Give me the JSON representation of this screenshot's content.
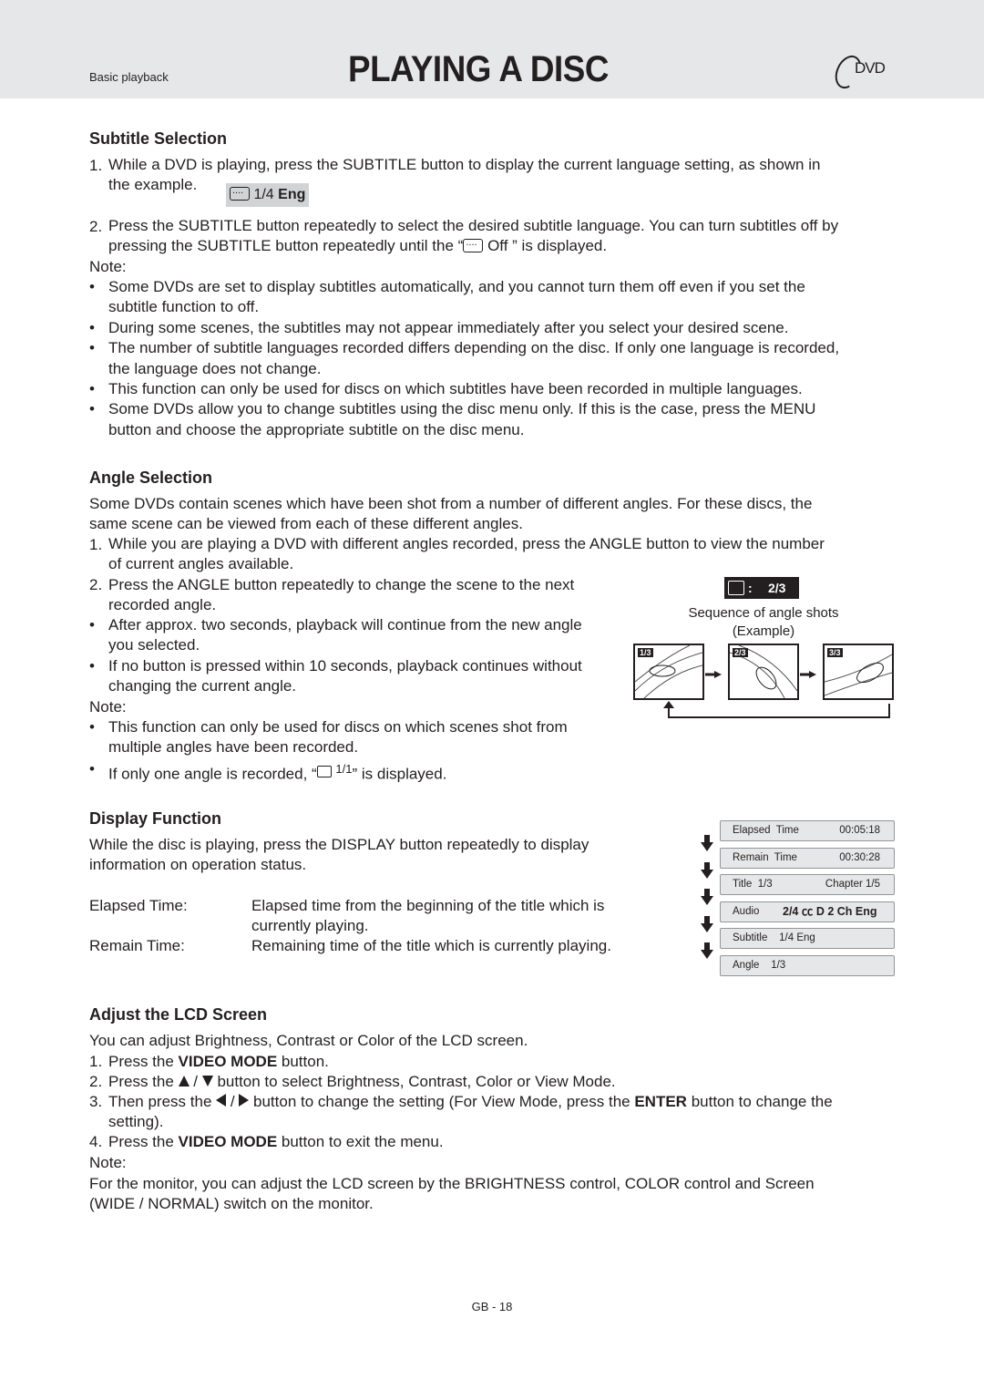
{
  "header": {
    "section": "Basic playback",
    "title": "PLAYING A DISC",
    "logo": "DVD"
  },
  "subtitle": {
    "heading": "Subtitle Selection",
    "step1_num": "1.",
    "step1_line1": "While a DVD is playing, press the SUBTITLE button to display the current language setting, as shown in",
    "step1_line2": "the example.",
    "osd_example": {
      "icon": "subtitle-icon",
      "value": "1/4",
      "lang": "Eng"
    },
    "step2_num": "2.",
    "step2_line1": "Press the SUBTITLE button repeatedly to select the desired subtitle language. You can turn subtitles off by",
    "step2_line2a": "pressing the SUBTITLE button repeatedly until the “",
    "step2_off": "Off",
    "step2_line2b": "” is displayed.",
    "note": "Note:",
    "bullets": [
      [
        "Some DVDs are set to display subtitles automatically, and you cannot turn them off even if you set the",
        "subtitle function to off."
      ],
      [
        "During some scenes, the subtitles may not appear immediately after you select your desired scene."
      ],
      [
        "The number of subtitle languages recorded differs depending on the disc. If only one language is recorded,",
        "the language does not change."
      ],
      [
        "This function can only be used for discs on which subtitles have been recorded in multiple languages."
      ],
      [
        "Some DVDs allow you to change subtitles using the disc menu only. If this is the case, press the MENU",
        "button and choose the appropriate subtitle on the disc menu."
      ]
    ]
  },
  "angle": {
    "heading": "Angle Selection",
    "intro1": "Some DVDs contain scenes which have been shot from a number of different angles. For these discs, the",
    "intro2": "same scene can be viewed from each of these different angles.",
    "step1_line1": "While you are playing a DVD with different angles recorded, press the ANGLE button to view the number",
    "step1_line2": "of current angles available.",
    "step2_line1": "Press the ANGLE button repeatedly to change the scene to the next",
    "step2_line2": "recorded angle.",
    "b1_line1": "After approx. two seconds, playback will continue from the new angle",
    "b1_line2": "you selected.",
    "b2_line1": "If no button is pressed within 10 seconds, playback continues without",
    "b2_line2": "changing the current angle.",
    "note": "Note:",
    "n1_line1": "This function can only be used for discs on which scenes shot from",
    "n1_line2": "multiple angles have been recorded.",
    "n2_a": "If only one angle is recorded, “",
    "n2_val": "1/1",
    "n2_b": "” is displayed.",
    "osd": {
      "sep": ":",
      "value": "2/3"
    },
    "caption1": "Sequence of angle shots",
    "caption2": "(Example)",
    "shots": [
      "1/3",
      "2/3",
      "3/3"
    ]
  },
  "display": {
    "heading": "Display Function",
    "intro1": "While the disc is playing, press the DISPLAY button repeatedly to display",
    "intro2": "information on operation status.",
    "defs": [
      {
        "term": "Elapsed Time:",
        "def1": "Elapsed time from the beginning of the title which is",
        "def2": "currently playing."
      },
      {
        "term": "Remain Time:",
        "def1": "Remaining time of the title which is currently playing.",
        "def2": ""
      }
    ],
    "osd_sequence": [
      {
        "label": "Elapsed  Time",
        "value": "00:05:18"
      },
      {
        "label": "Remain  Time",
        "value": "00:30:28"
      },
      {
        "label": "Title  1/3",
        "value": "Chapter  1/5"
      },
      {
        "label": "Audio",
        "value": "2/4 ㏄ D 2 Ch Eng"
      },
      {
        "label": "Subtitle    1/4 Eng",
        "value": ""
      },
      {
        "label": "Angle    1/3",
        "value": ""
      }
    ]
  },
  "lcd": {
    "heading": "Adjust the LCD Screen",
    "intro": "You can adjust Brightness, Contrast or Color of the LCD screen.",
    "s1a": "Press the ",
    "s1b": "VIDEO MODE",
    "s1c": " button.",
    "s2a": "Press the ",
    "s2b": " button to select Brightness, Contrast, Color or View Mode.",
    "s3a": "Then press the ",
    "s3b": " button to change the setting (For View Mode, press the ",
    "s3c": "ENTER",
    "s3d": " button to change the",
    "s3e": "setting).",
    "s4a": "Press the ",
    "s4b": "VIDEO MODE",
    "s4c": " button to exit the menu.",
    "note": "Note:",
    "note1": "For the monitor, you can adjust the LCD screen by the BRIGHTNESS control, COLOR control and Screen",
    "note2": "(WIDE / NORMAL) switch on the monitor."
  },
  "footer": {
    "page": "GB - 18"
  }
}
